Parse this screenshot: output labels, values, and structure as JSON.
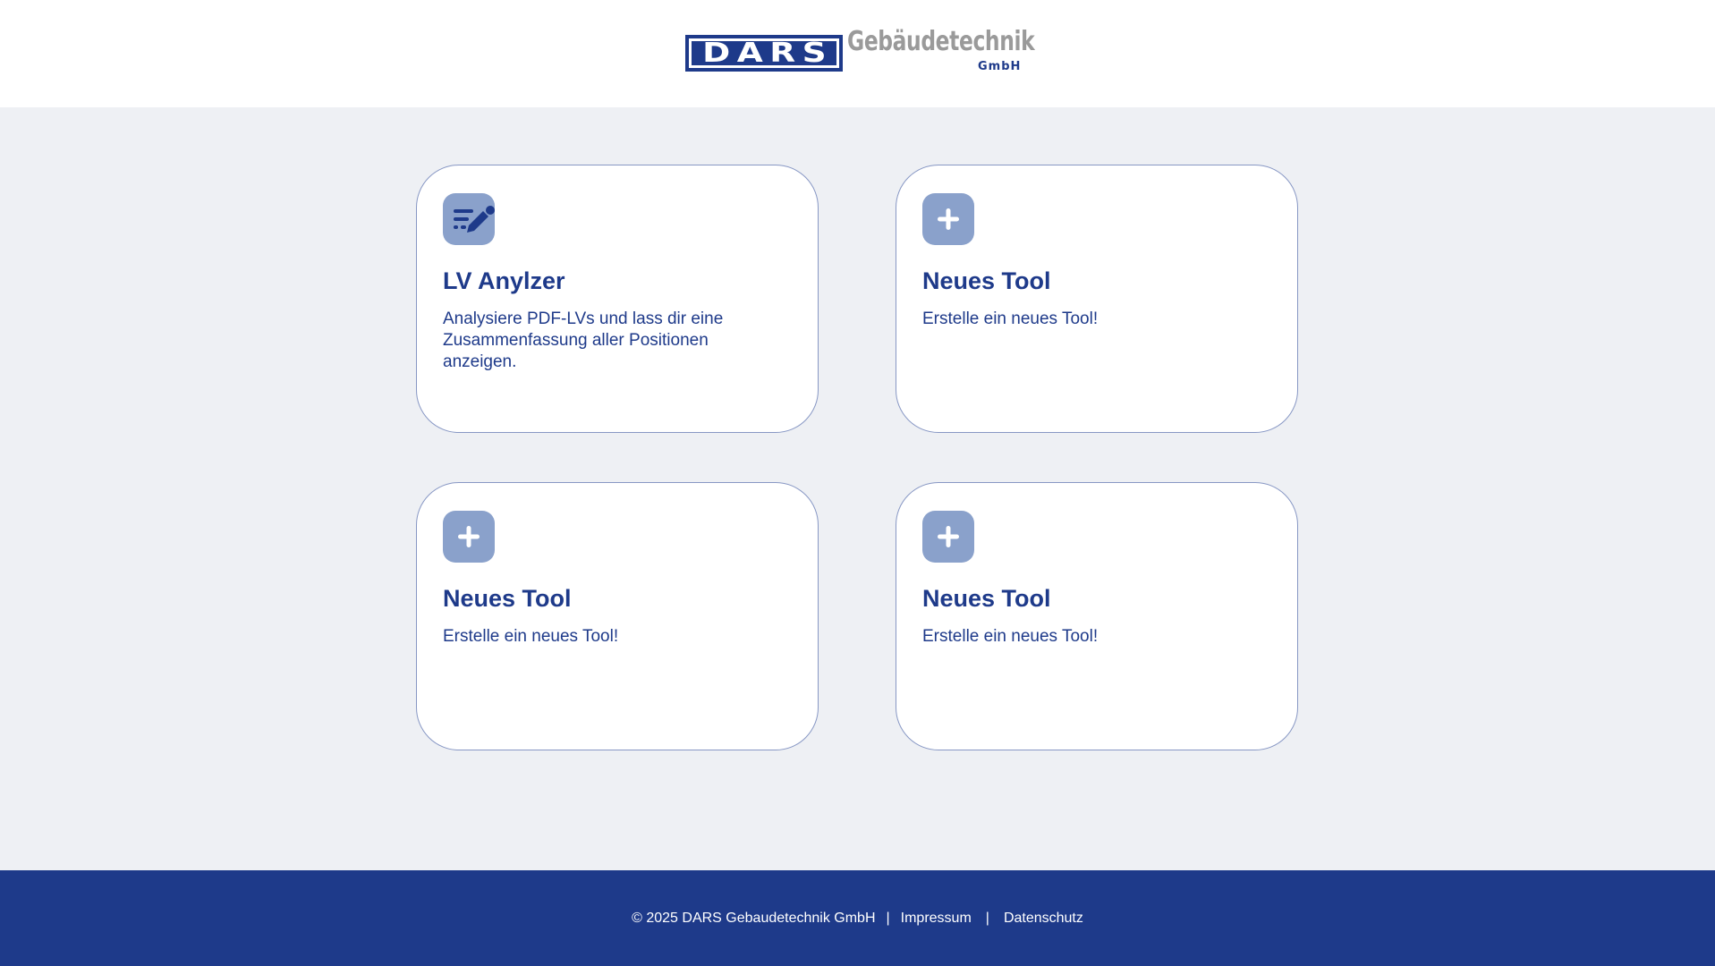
{
  "header": {
    "logo": {
      "box_text": "DARS",
      "word": "Gebäudetechnik",
      "sub": "GmbH"
    }
  },
  "cards": [
    {
      "icon": "edit-document-icon",
      "title": "LV Anylzer",
      "description": "Analysiere PDF-LVs und lass dir eine Zusammenfassung aller Positionen anzeigen."
    },
    {
      "icon": "plus-icon",
      "title": "Neues Tool",
      "description": "Erstelle ein neues Tool!"
    },
    {
      "icon": "plus-icon",
      "title": "Neues Tool",
      "description": "Erstelle ein neues Tool!"
    },
    {
      "icon": "plus-icon",
      "title": "Neues Tool",
      "description": "Erstelle ein neues Tool!"
    }
  ],
  "footer": {
    "copyright": "© 2025 DARS Gebaudetechnik GmbH",
    "separator": "|",
    "impressum": "Impressum",
    "datenschutz": "Datenschutz"
  },
  "colors": {
    "brand": "#1e3a8a",
    "icon_bg": "#8aa1cb",
    "page_bg": "#eef0f4",
    "card_border": "#8797c4"
  }
}
